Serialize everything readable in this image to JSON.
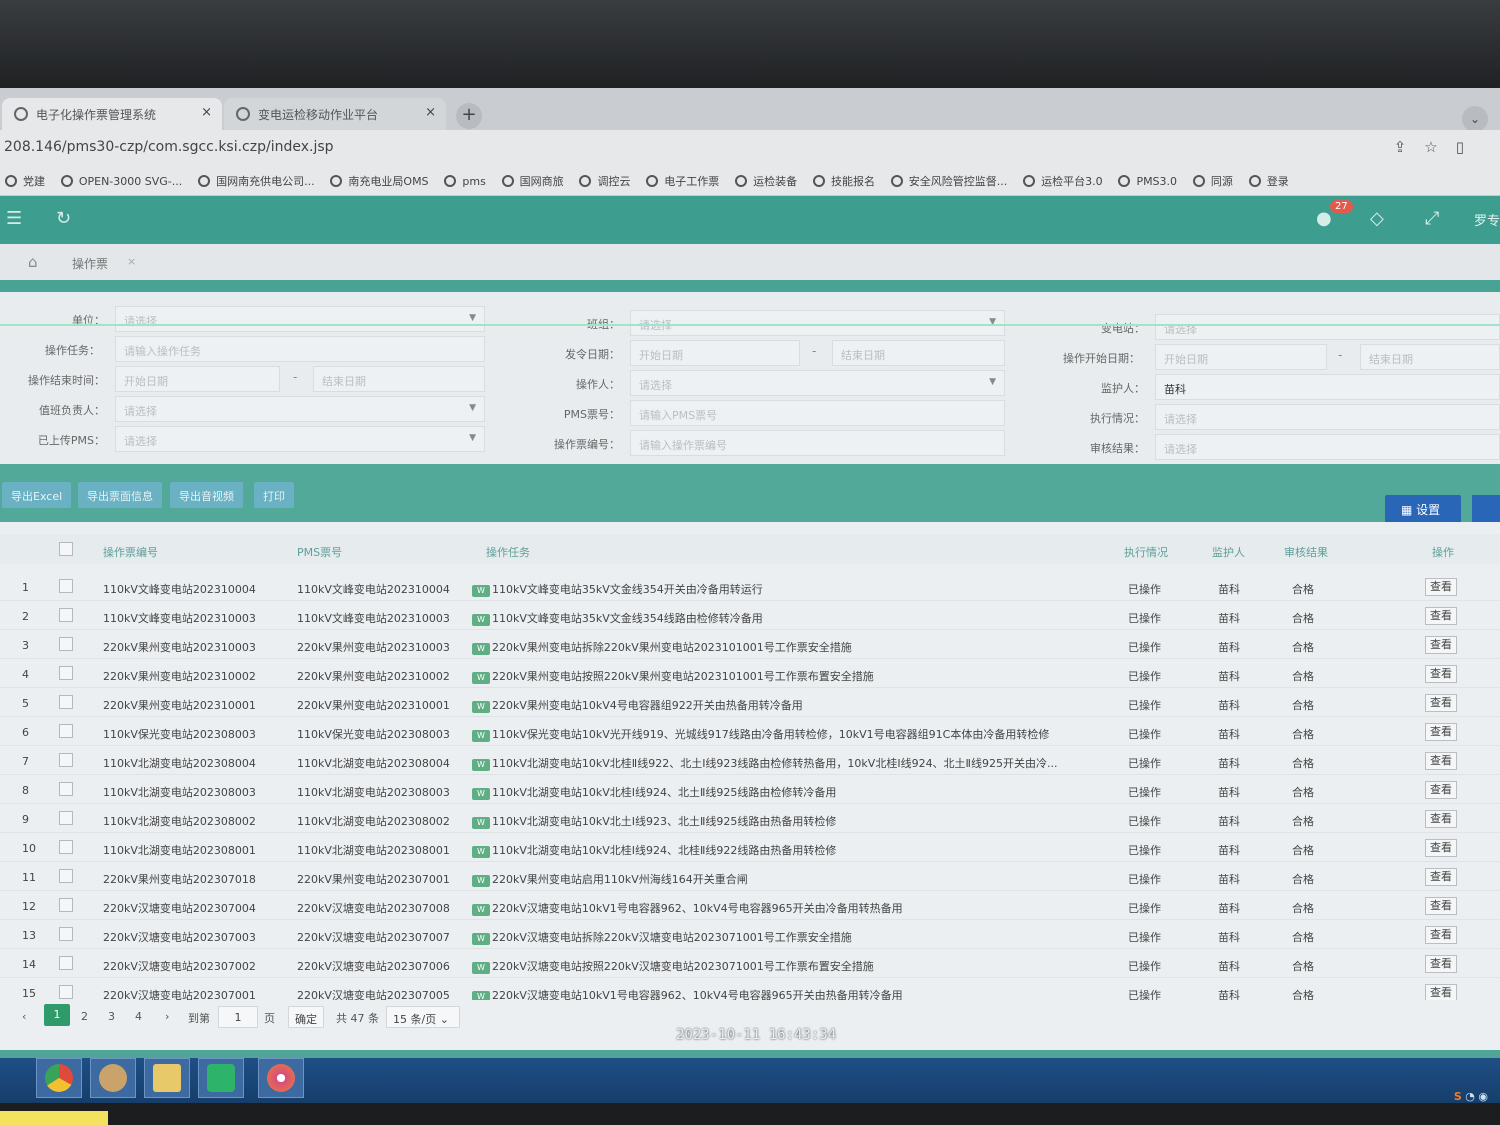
{
  "browser": {
    "tabs": [
      {
        "label": "电子化操作票管理系统"
      },
      {
        "label": "变电运检移动作业平台"
      }
    ],
    "url": "208.146/pms30-czp/com.sgcc.ksi.czp/index.jsp",
    "bookmarks": [
      "党建",
      "OPEN-3000 SVG-...",
      "国网南充供电公司...",
      "南充电业局OMS",
      "pms",
      "国网商旅",
      "调控云",
      "电子工作票",
      "运检装备",
      "技能报名",
      "安全风险管控监督...",
      "运检平台3.0",
      "PMS3.0",
      "同源",
      "登录"
    ]
  },
  "header": {
    "notification_count": "27",
    "user": "罗专"
  },
  "breadcrumb": {
    "title": "操作票"
  },
  "filters": {
    "unit": {
      "label": "单位：",
      "placeholder": "请选择"
    },
    "task": {
      "label": "操作任务：",
      "placeholder": "请输入操作任务"
    },
    "end_time": {
      "label": "操作结束时间：",
      "start": "开始日期",
      "end": "结束日期"
    },
    "duty_person": {
      "label": "值班负责人：",
      "placeholder": "请选择"
    },
    "uploaded_pms": {
      "label": "已上传PMS：",
      "placeholder": "请选择"
    },
    "team": {
      "label": "班组：",
      "placeholder": "请选择"
    },
    "issue_date": {
      "label": "发令日期：",
      "start": "开始日期",
      "end": "结束日期"
    },
    "operator": {
      "label": "操作人：",
      "placeholder": "请选择"
    },
    "pms_no": {
      "label": "PMS票号：",
      "placeholder": "请输入PMS票号"
    },
    "ticket_no": {
      "label": "操作票编号：",
      "placeholder": "请输入操作票编号"
    },
    "substation": {
      "label": "变电站：",
      "placeholder": "请选择"
    },
    "start_date": {
      "label": "操作开始日期：",
      "start": "开始日期",
      "end": "结束日期"
    },
    "guardian": {
      "label": "监护人：",
      "value": "苗科"
    },
    "exec_status": {
      "label": "执行情况：",
      "placeholder": "请选择"
    },
    "review_result": {
      "label": "审核结果：",
      "placeholder": "请选择"
    }
  },
  "toolbar": {
    "export_excel": "导出Excel",
    "export_ticket_info": "导出票面信息",
    "export_av": "导出音视频",
    "print": "打印",
    "settings": "设置"
  },
  "table": {
    "columns": {
      "ticket_no": "操作票编号",
      "pms_no": "PMS票号",
      "task": "操作任务",
      "status": "执行情况",
      "guardian": "监护人",
      "review": "审核结果",
      "action": "操作"
    },
    "rows": [
      {
        "idx": "1",
        "ticket_no": "110kV文峰变电站202310004",
        "pms_no": "110kV文峰变电站202310004",
        "task": "110kV文峰变电站35kV文金线354开关由冷备用转运行",
        "status": "已操作",
        "guardian": "苗科",
        "review": "合格",
        "action": "查看"
      },
      {
        "idx": "2",
        "ticket_no": "110kV文峰变电站202310003",
        "pms_no": "110kV文峰变电站202310003",
        "task": "110kV文峰变电站35kV文金线354线路由检修转冷备用",
        "status": "已操作",
        "guardian": "苗科",
        "review": "合格",
        "action": "查看"
      },
      {
        "idx": "3",
        "ticket_no": "220kV果州变电站202310003",
        "pms_no": "220kV果州变电站202310003",
        "task": "220kV果州变电站拆除220kV果州变电站2023101001号工作票安全措施",
        "status": "已操作",
        "guardian": "苗科",
        "review": "合格",
        "action": "查看"
      },
      {
        "idx": "4",
        "ticket_no": "220kV果州变电站202310002",
        "pms_no": "220kV果州变电站202310002",
        "task": "220kV果州变电站按照220kV果州变电站2023101001号工作票布置安全措施",
        "status": "已操作",
        "guardian": "苗科",
        "review": "合格",
        "action": "查看"
      },
      {
        "idx": "5",
        "ticket_no": "220kV果州变电站202310001",
        "pms_no": "220kV果州变电站202310001",
        "task": "220kV果州变电站10kV4号电容器组922开关由热备用转冷备用",
        "status": "已操作",
        "guardian": "苗科",
        "review": "合格",
        "action": "查看"
      },
      {
        "idx": "6",
        "ticket_no": "110kV保光变电站202308003",
        "pms_no": "110kV保光变电站202308003",
        "task": "110kV保光变电站10kV光开线919、光城线917线路由冷备用转检修，10kV1号电容器组91C本体由冷备用转检修",
        "status": "已操作",
        "guardian": "苗科",
        "review": "合格",
        "action": "查看"
      },
      {
        "idx": "7",
        "ticket_no": "110kV北湖变电站202308004",
        "pms_no": "110kV北湖变电站202308004",
        "task": "110kV北湖变电站10kV北桂Ⅱ线922、北土Ⅰ线923线路由检修转热备用，10kV北桂Ⅰ线924、北土Ⅱ线925开关由冷...",
        "status": "已操作",
        "guardian": "苗科",
        "review": "合格",
        "action": "查看"
      },
      {
        "idx": "8",
        "ticket_no": "110kV北湖变电站202308003",
        "pms_no": "110kV北湖变电站202308003",
        "task": "110kV北湖变电站10kV北桂Ⅰ线924、北土Ⅱ线925线路由检修转冷备用",
        "status": "已操作",
        "guardian": "苗科",
        "review": "合格",
        "action": "查看"
      },
      {
        "idx": "9",
        "ticket_no": "110kV北湖变电站202308002",
        "pms_no": "110kV北湖变电站202308002",
        "task": "110kV北湖变电站10kV北土Ⅰ线923、北土Ⅱ线925线路由热备用转检修",
        "status": "已操作",
        "guardian": "苗科",
        "review": "合格",
        "action": "查看"
      },
      {
        "idx": "10",
        "ticket_no": "110kV北湖变电站202308001",
        "pms_no": "110kV北湖变电站202308001",
        "task": "110kV北湖变电站10kV北桂Ⅰ线924、北桂Ⅱ线922线路由热备用转检修",
        "status": "已操作",
        "guardian": "苗科",
        "review": "合格",
        "action": "查看"
      },
      {
        "idx": "11",
        "ticket_no": "220kV果州变电站202307018",
        "pms_no": "220kV果州变电站202307001",
        "task": "220kV果州变电站启用110kV州海线164开关重合闸",
        "status": "已操作",
        "guardian": "苗科",
        "review": "合格",
        "action": "查看"
      },
      {
        "idx": "12",
        "ticket_no": "220kV汉塘变电站202307004",
        "pms_no": "220kV汉塘变电站202307008",
        "task": "220kV汉塘变电站10kV1号电容器962、10kV4号电容器965开关由冷备用转热备用",
        "status": "已操作",
        "guardian": "苗科",
        "review": "合格",
        "action": "查看"
      },
      {
        "idx": "13",
        "ticket_no": "220kV汉塘变电站202307003",
        "pms_no": "220kV汉塘变电站202307007",
        "task": "220kV汉塘变电站拆除220kV汉塘变电站2023071001号工作票安全措施",
        "status": "已操作",
        "guardian": "苗科",
        "review": "合格",
        "action": "查看"
      },
      {
        "idx": "14",
        "ticket_no": "220kV汉塘变电站202307002",
        "pms_no": "220kV汉塘变电站202307006",
        "task": "220kV汉塘变电站按照220kV汉塘变电站2023071001号工作票布置安全措施",
        "status": "已操作",
        "guardian": "苗科",
        "review": "合格",
        "action": "查看"
      },
      {
        "idx": "15",
        "ticket_no": "220kV汉塘变电站202307001",
        "pms_no": "220kV汉塘变电站202307005",
        "task": "220kV汉塘变电站10kV1号电容器962、10kV4号电容器965开关由热备用转冷备用",
        "status": "已操作",
        "guardian": "苗科",
        "review": "合格",
        "action": "查看"
      }
    ]
  },
  "pager": {
    "pages": [
      "1",
      "2",
      "3",
      "4"
    ],
    "goto_label": "到第",
    "goto_value": "1",
    "page_unit": "页",
    "confirm": "确定",
    "total": "共 47 条",
    "page_size": "15 条/页"
  },
  "timestamp": "2023-10-11 16:43:34"
}
